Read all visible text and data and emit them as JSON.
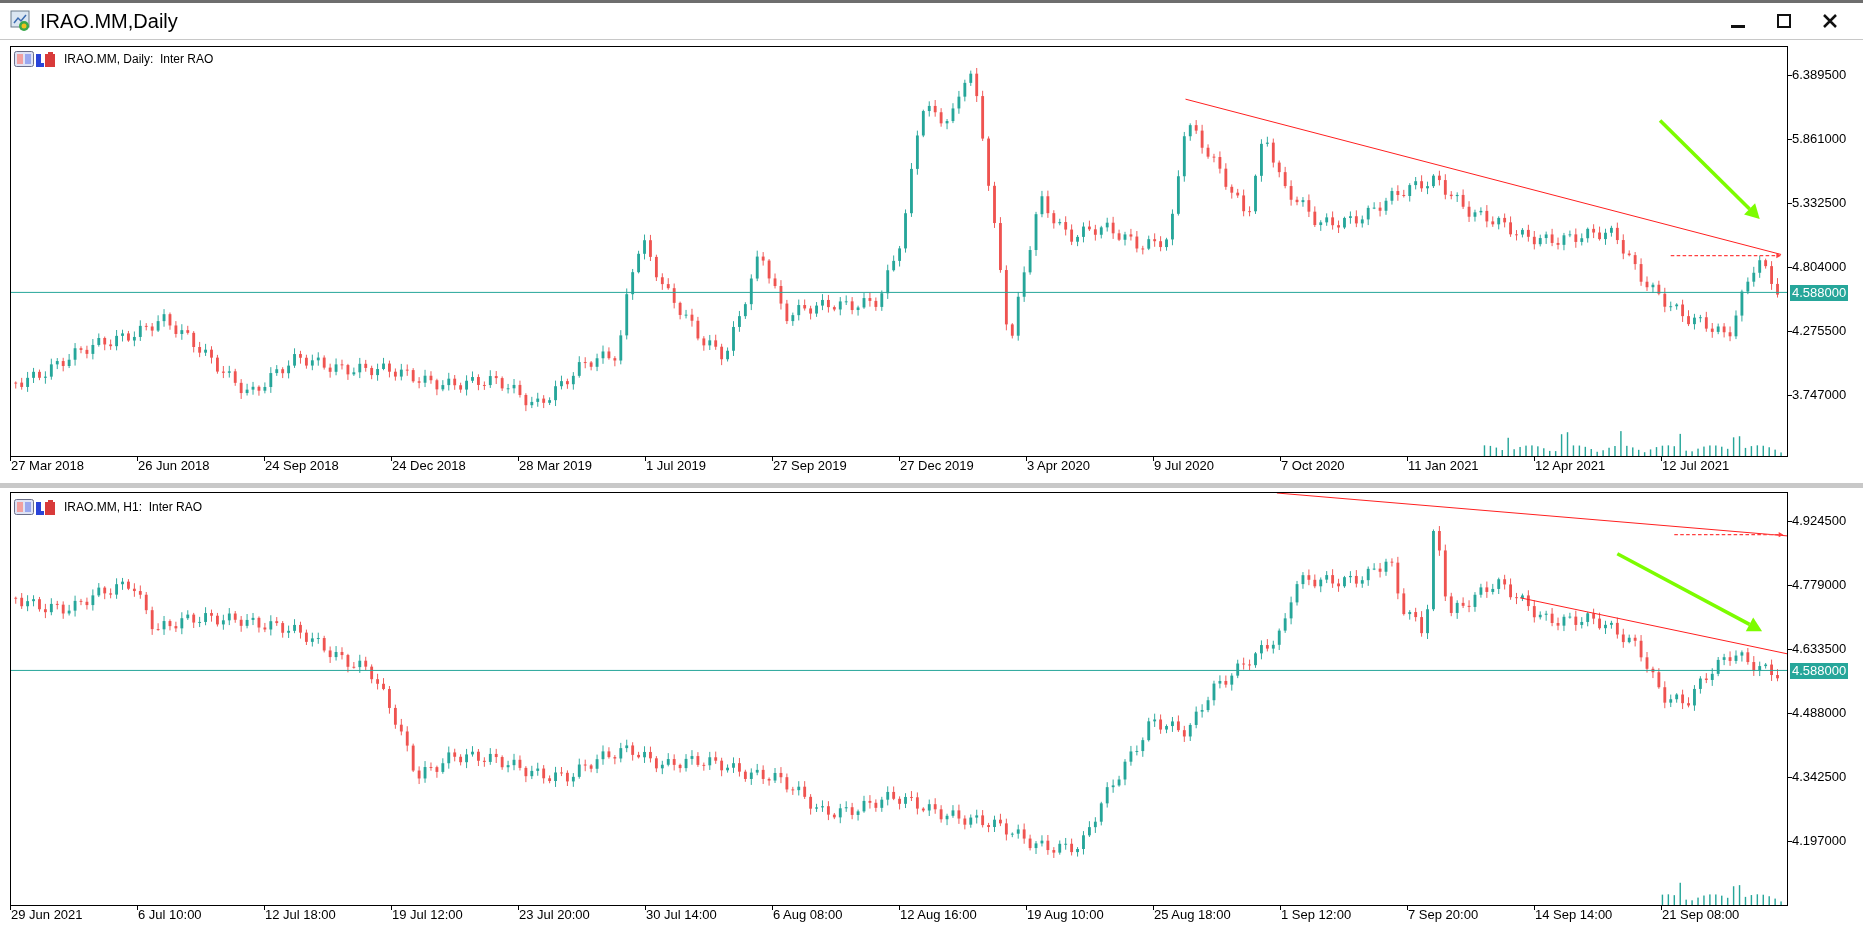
{
  "window": {
    "title": "IRAO.MM,Daily"
  },
  "charts": [
    {
      "header": "IRAO.MM, Daily:  Inter RAO",
      "price_labels": [
        "6.389500",
        "5.861000",
        "5.332500",
        "4.804000",
        "4.275500",
        "3.747000"
      ],
      "current_price": "4.588000",
      "time_labels": [
        "27 Mar 2018",
        "26 Jun 2018",
        "24 Sep 2018",
        "24 Dec 2018",
        "28 Mar 2019",
        "1 Jul 2019",
        "27 Sep 2019",
        "27 Dec 2019",
        "3 Apr 2020",
        "9 Jul 2020",
        "7 Oct 2020",
        "11 Jan 2021",
        "12 Apr 2021",
        "12 Jul 2021"
      ]
    },
    {
      "header": "IRAO.MM, H1:  Inter RAO",
      "price_labels": [
        "4.924500",
        "4.779000",
        "4.633500",
        "4.488000",
        "4.342500",
        "4.197000"
      ],
      "current_price": "4.588000",
      "time_labels": [
        "29 Jun 2021",
        "6 Jul 10:00",
        "12 Jul 18:00",
        "19 Jul 12:00",
        "23 Jul 20:00",
        "30 Jul 14:00",
        "6 Aug 08:00",
        "12 Aug 16:00",
        "19 Aug 10:00",
        "25 Aug 18:00",
        "1 Sep 12:00",
        "7 Sep 20:00",
        "14 Sep 14:00",
        "21 Sep 08:00"
      ]
    }
  ]
}
